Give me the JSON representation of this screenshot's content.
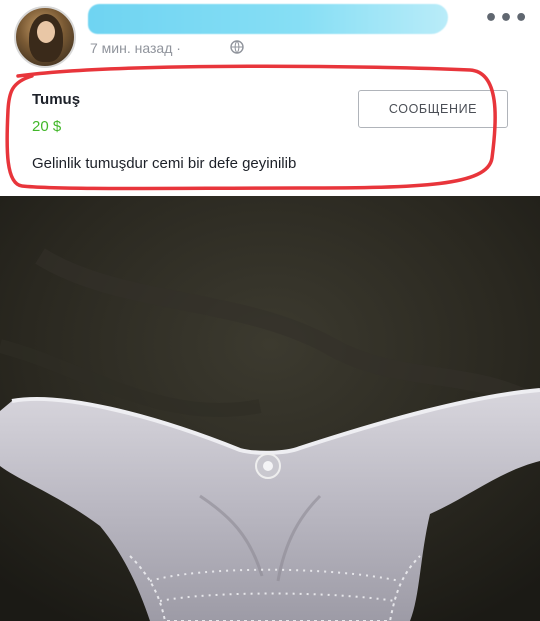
{
  "post": {
    "time": "7 мин. назад ·",
    "more_icon": "more-icon",
    "privacy_icon": "globe-icon"
  },
  "listing": {
    "title": "Tumuş",
    "price": "20 $",
    "message_button": "СООБЩЕНИЕ",
    "description": "Gelinlik tumuşdur cemi bir defe geyinilib"
  },
  "colors": {
    "price": "#42b72a",
    "annotation": "#e8353b",
    "redaction": "#7fdcf4"
  }
}
